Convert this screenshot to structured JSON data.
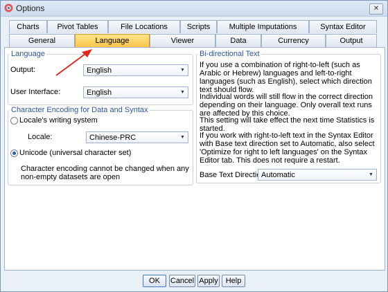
{
  "window": {
    "title": "Options"
  },
  "tabs_row1": [
    "Charts",
    "Pivot Tables",
    "File Locations",
    "Scripts",
    "Multiple Imputations",
    "Syntax Editor"
  ],
  "tabs_row2": [
    "General",
    "Language",
    "Viewer",
    "Data",
    "Currency",
    "Output"
  ],
  "active_tab": "Language",
  "language": {
    "legend": "Language",
    "output_label": "Output:",
    "output_value": "English",
    "ui_label": "User Interface:",
    "ui_value": "English"
  },
  "encoding": {
    "legend": "Character Encoding for Data and Syntax",
    "locale_radio": "Locale's writing system",
    "locale_label": "Locale:",
    "locale_value": "Chinese-PRC",
    "unicode_radio": "Unicode (universal character set)",
    "selected": "unicode",
    "note": "Character encoding cannot be changed when any non-empty datasets are open"
  },
  "bidi": {
    "legend": "Bi-directional Text",
    "p1": "If you use a combination of right-to-left (such as Arabic or Hebrew) languages and left-to-right languages (such as English), select which direction text should flow.",
    "p2": "Individual words will still flow in the correct direction depending on their language. Only overall text runs are affected by this choice.",
    "p3": "This setting will take effect the next time Statistics is started.",
    "p4": "If you work with right-to-left text in the Syntax Editor with Base text direction set to Automatic, also select 'Optimize for right to left languages' on the Syntax Editor tab. This does not require a restart.",
    "base_label": "Base Text Direction:",
    "base_value": "Automatic"
  },
  "buttons": {
    "ok": "OK",
    "cancel": "Cancel",
    "apply": "Apply",
    "help": "Help"
  },
  "icons": {
    "app": "options-app-icon",
    "close": "close-icon",
    "dropdown": "chevron-down-icon",
    "arrow": "red-arrow-annotation"
  },
  "colors": {
    "active_tab": "#f9c64a",
    "legend": "#2b55a0",
    "annotation": "#e0281e"
  }
}
